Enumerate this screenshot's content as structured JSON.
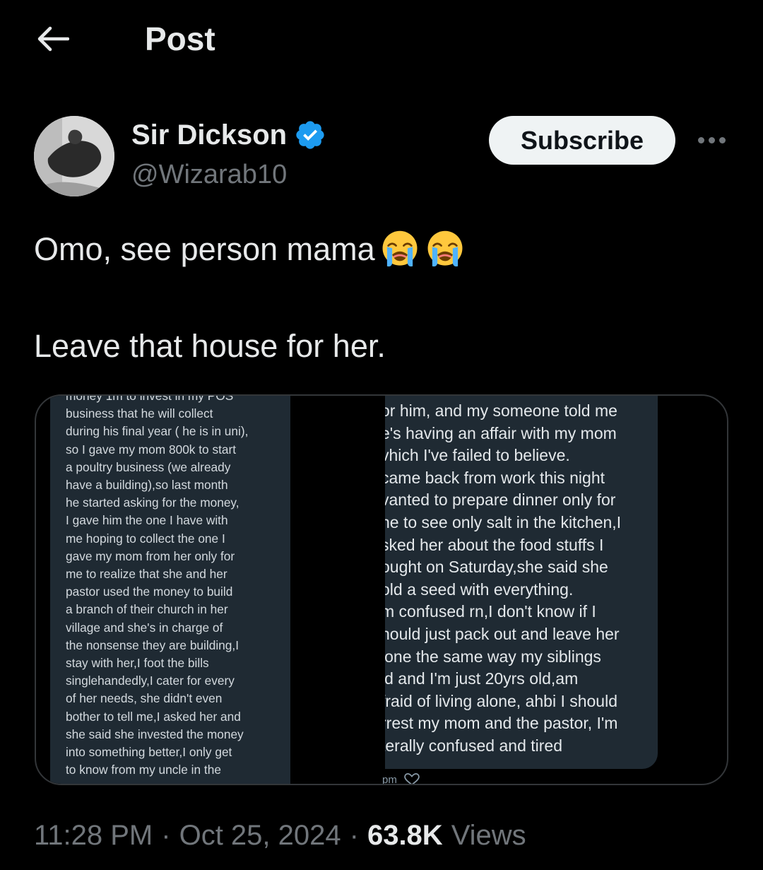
{
  "header": {
    "title": "Post"
  },
  "author": {
    "name": "Sir Dickson",
    "handle": "@Wizarab10"
  },
  "actions": {
    "subscribe_label": "Subscribe"
  },
  "tweet": {
    "line1": "Omo, see person mama",
    "line2": "Leave that house for her."
  },
  "media": {
    "left_lines": [
      "money 1m to invest in my POS",
      "business that he will collect",
      "during his final year ( he is in uni),",
      "so I gave my mom 800k to start",
      "a poultry business (we already",
      "have a building),so last month",
      "he started asking for the money,",
      "I gave him the one I have with",
      "me hoping to collect the one I",
      "gave my mom from her only for",
      "me to realize that she and her",
      "pastor used the money to build",
      "a branch of their church in her",
      "village and she's in charge of",
      "the nonsense they are building,I",
      "stay with her,I foot the bills",
      "singlehandedly,I cater for every",
      "of her needs, she didn't even",
      "bother to tell me,I asked her and",
      "she said she invested the money",
      "into something better,I only get",
      "to know from my uncle in the"
    ],
    "right_lines": [
      "or him, and my someone told me",
      "e's having an affair with my mom",
      "vhich I've failed to believe.",
      "came back  from work this night",
      "vanted to prepare dinner only for",
      "ne to see only salt in the kitchen,I",
      "sked her about the food stuffs I",
      "ought on Saturday,she said she",
      "old a seed with everything.",
      "m confused rn,I don't know if I",
      "hould just pack out and leave her",
      "lone the same way my siblings",
      "id and I'm just 20yrs old,am",
      "fraid of living alone, ahbi I should",
      "rrest my mom and the pastor, I'm",
      "terally confused and tired"
    ],
    "right_meta": "pm"
  },
  "meta": {
    "time": "11:28 PM",
    "sep1": "·",
    "date": "Oct 25, 2024",
    "sep2": "·",
    "views_count": "63.8K",
    "views_label": "Views"
  },
  "colors": {
    "verified": "#1d9bf0",
    "background": "#000000",
    "secondary_text": "#71767b"
  },
  "icons": {
    "back": "arrow-left-icon",
    "verified": "verified-badge-icon",
    "more": "more-horizontal-icon",
    "emoji": "loudly-crying-face-emoji"
  }
}
